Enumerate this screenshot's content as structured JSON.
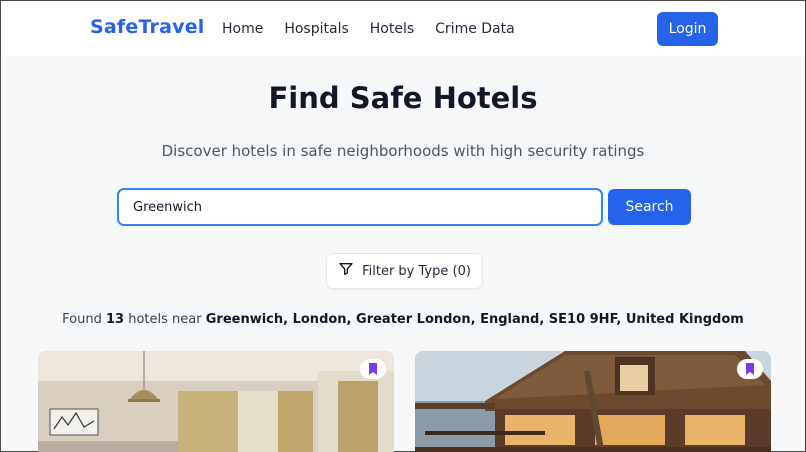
{
  "nav": {
    "brand": "SafeTravel",
    "links": [
      "Home",
      "Hospitals",
      "Hotels",
      "Crime Data"
    ],
    "login_label": "Login"
  },
  "hero": {
    "title": "Find Safe Hotels",
    "subtitle": "Discover hotels in safe neighborhoods with high security ratings"
  },
  "search": {
    "value": "Greenwich",
    "button_label": "Search"
  },
  "filter": {
    "label": "Filter by Type (0)",
    "icon": "funnel-icon"
  },
  "results": {
    "prefix": "Found",
    "count": "13",
    "middle": "hotels near",
    "location": "Greenwich, London, Greater London, England, SE10 9HF, United Kingdom"
  },
  "cards": [
    {
      "image": "hotel-room-photo",
      "bookmark_icon": "bookmark-icon"
    },
    {
      "image": "resort-exterior-photo",
      "bookmark_icon": "bookmark-icon"
    }
  ],
  "colors": {
    "accent": "#2563eb",
    "bookmark": "#7c3aed"
  }
}
